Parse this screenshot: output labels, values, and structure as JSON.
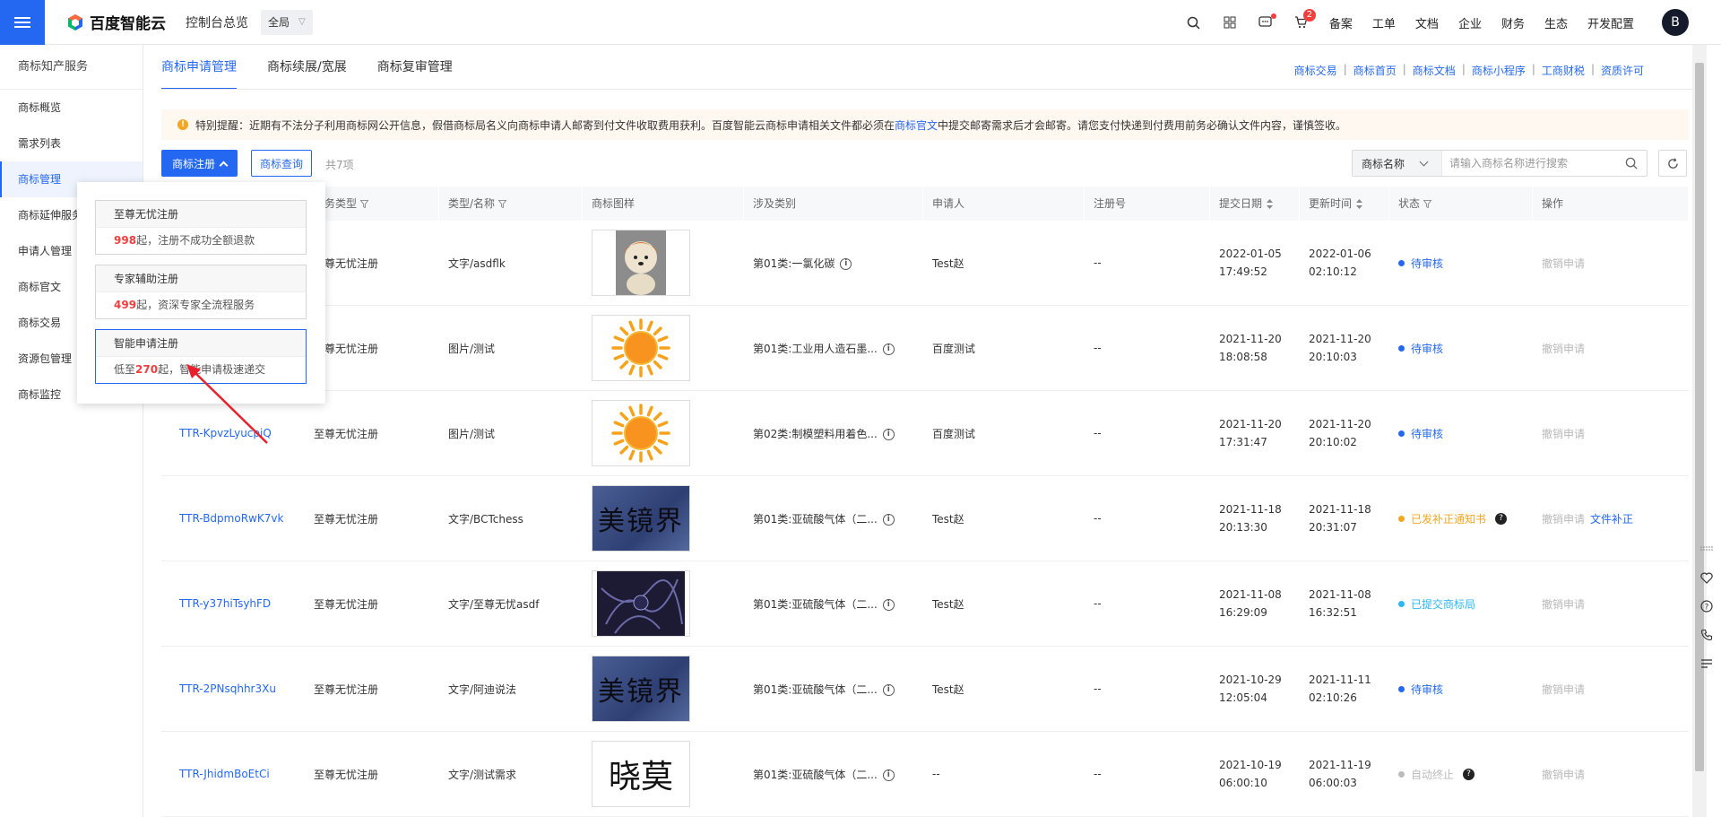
{
  "topbar": {
    "brand": "百度智能云",
    "overview": "控制台总览",
    "region": "全局",
    "cart_badge": "2",
    "links": [
      "备案",
      "工单",
      "文档",
      "企业",
      "财务",
      "生态",
      "开发配置"
    ],
    "avatar": "B"
  },
  "sidebar": {
    "title": "商标知产服务",
    "items": [
      "商标概览",
      "需求列表",
      "商标管理",
      "商标延伸服务",
      "申请人管理",
      "商标官文",
      "商标交易",
      "资源包管理",
      "商标监控"
    ]
  },
  "tabs": [
    "商标申请管理",
    "商标续展/宽展",
    "商标复审管理"
  ],
  "quick_links": [
    "商标交易",
    "商标首页",
    "商标文档",
    "商标小程序",
    "工商财税",
    "资质许可"
  ],
  "notice": {
    "text_before": "特别提醒：近期有不法分子利用商标网公开信息，假借商标局名义向商标申请人邮寄到付文件收取费用获利。百度智能云商标申请相关文件都必须在",
    "link": "商标官文",
    "text_after": "中提交邮寄需求后才会邮寄。请您支付快递到付费用前务必确认文件内容，谨慎签收。"
  },
  "toolbar": {
    "register_label": "商标注册",
    "query_label": "商标查询",
    "total": "共7项",
    "search_select": "商标名称",
    "search_placeholder": "请输入商标名称进行搜索"
  },
  "table": {
    "headers": [
      "服务类型",
      "类型/名称",
      "商标图样",
      "涉及类别",
      "申请人",
      "注册号",
      "提交日期",
      "更新时间",
      "状态",
      "操作"
    ],
    "rows": [
      {
        "id": "",
        "svc": "至尊无忧注册",
        "type": "文字/asdflk",
        "img": "dog",
        "cls": "第01类:一氯化碳",
        "applicant": "Test赵",
        "reg": "--",
        "sub_d": "2022-01-05",
        "sub_t": "17:49:52",
        "upd_d": "2022-01-06",
        "upd_t": "02:10:12",
        "status": "待审核",
        "status_color": "#2468f2",
        "help": false,
        "op": "撤销申请",
        "op2": ""
      },
      {
        "id": "",
        "svc": "至尊无忧注册",
        "type": "图片/测试",
        "img": "sun",
        "cls": "第01类:工业用人造石墨...",
        "applicant": "百度测试",
        "reg": "--",
        "sub_d": "2021-11-20",
        "sub_t": "18:08:58",
        "upd_d": "2021-11-20",
        "upd_t": "20:10:03",
        "status": "待审核",
        "status_color": "#2468f2",
        "help": false,
        "op": "撤销申请",
        "op2": ""
      },
      {
        "id": "TTR-KpvzLyucpiQ",
        "svc": "至尊无忧注册",
        "type": "图片/测试",
        "img": "sun",
        "cls": "第02类:制模塑料用着色...",
        "applicant": "百度测试",
        "reg": "--",
        "sub_d": "2021-11-20",
        "sub_t": "17:31:47",
        "upd_d": "2021-11-20",
        "upd_t": "20:10:02",
        "status": "待审核",
        "status_color": "#2468f2",
        "help": false,
        "op": "撤销申请",
        "op2": ""
      },
      {
        "id": "TTR-BdpmoRwK7vk",
        "svc": "至尊无忧注册",
        "type": "文字/BCTchess",
        "img": "calli",
        "cls": "第01类:亚硫酸气体（二...",
        "applicant": "Test赵",
        "reg": "--",
        "sub_d": "2021-11-18",
        "sub_t": "20:13:30",
        "upd_d": "2021-11-18",
        "upd_t": "20:31:07",
        "status": "已发补正通知书",
        "status_color": "#f5a623",
        "help": true,
        "op": "撤销申请",
        "op2": "文件补正"
      },
      {
        "id": "TTR-y37hiTsyhFD",
        "svc": "至尊无忧注册",
        "type": "文字/至尊无忧asdf",
        "img": "dark",
        "cls": "第01类:亚硫酸气体（二...",
        "applicant": "Test赵",
        "reg": "--",
        "sub_d": "2021-11-08",
        "sub_t": "16:29:09",
        "upd_d": "2021-11-08",
        "upd_t": "16:32:51",
        "status": "已提交商标局",
        "status_color": "#2db7f5",
        "help": false,
        "op": "撤销申请",
        "op2": ""
      },
      {
        "id": "TTR-2PNsqhhr3Xu",
        "svc": "至尊无忧注册",
        "type": "文字/阿迪说法",
        "img": "calli",
        "cls": "第01类:亚硫酸气体（二...",
        "applicant": "Test赵",
        "reg": "--",
        "sub_d": "2021-10-29",
        "sub_t": "12:05:04",
        "upd_d": "2021-11-11",
        "upd_t": "02:10:26",
        "status": "待审核",
        "status_color": "#2468f2",
        "help": false,
        "op": "撤销申请",
        "op2": ""
      },
      {
        "id": "TTR-JhidmBoEtCi",
        "svc": "至尊无忧注册",
        "type": "文字/测试需求",
        "img": "xiaomo",
        "cls": "第01类:亚硫酸气体（二...",
        "applicant": "--",
        "reg": "--",
        "sub_d": "2021-10-19",
        "sub_t": "06:00:10",
        "upd_d": "2021-11-19",
        "upd_t": "06:00:03",
        "status": "自动终止",
        "status_color": "#bbbbbb",
        "help": true,
        "op": "撤销申请",
        "op2": ""
      }
    ]
  },
  "thumb_text": {
    "calli": "美镜界",
    "xiaomo": "晓莫"
  },
  "popup": {
    "options": [
      {
        "title": "至尊无忧注册",
        "price": "998",
        "pre": "",
        "desc": "起，注册不成功全额退款"
      },
      {
        "title": "专家辅助注册",
        "price": "499",
        "pre": "",
        "desc": "起，资深专家全流程服务"
      },
      {
        "title": "智能申请注册",
        "price": "270",
        "pre": "低至",
        "desc": "起，智能申请极速递交"
      }
    ]
  },
  "colors": {
    "accent": "#2468f2",
    "warning": "#f5a623",
    "danger": "#f33e3e"
  }
}
